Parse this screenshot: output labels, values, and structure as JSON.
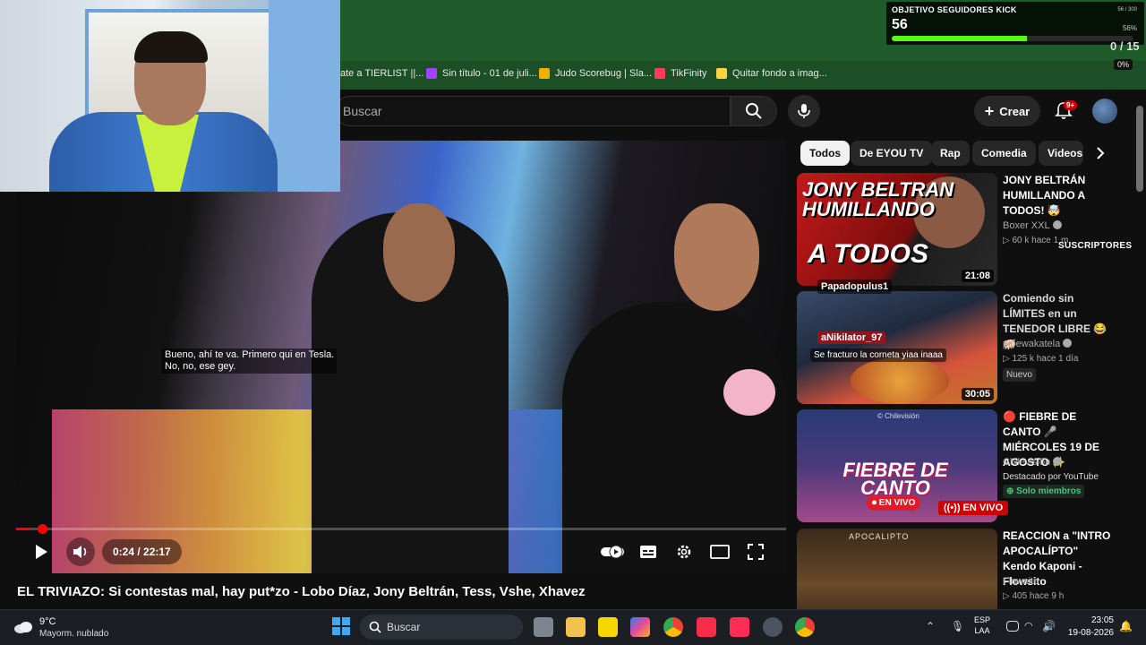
{
  "kick": {
    "title": "OBJETIVO SEGUIDORES KICK",
    "count": "56",
    "goal_small": "56 / 300",
    "percent": "56%",
    "progress": 0.56,
    "counter": "0 / 15",
    "badge": "0%"
  },
  "bookmarks": [
    {
      "label": "ate a TIERLIST ||...",
      "color": "#1c4f25"
    },
    {
      "label": "Sin título - 01 de juli...",
      "color": "#a640ff"
    },
    {
      "label": "Judo Scorebug | Sla...",
      "color": "#f0b000"
    },
    {
      "label": "TikFinity",
      "color": "#ff3b5c"
    },
    {
      "label": "Quitar fondo a imag...",
      "color": "#ffd23f"
    }
  ],
  "header": {
    "search_placeholder": "Buscar",
    "create_label": "Crear",
    "notifications": "9+"
  },
  "player": {
    "subtitle": "Bueno, ahí te va. Primero qui en Tesla.\nNo, no, ese gey.",
    "time": "0:24 / 22:17",
    "progress": 0.018
  },
  "video_title": "EL TRIVIAZO: Si contestas mal, hay put*zo - Lobo Díaz, Jony Beltrán, Tess, Vshe, Xhavez",
  "chips": [
    "Todos",
    "De EYOU TV",
    "Rap",
    "Comedia",
    "Videos"
  ],
  "recs": [
    {
      "title": "JONY BELTRÁN HUMILLANDO A TODOS! 🤯",
      "channel": "Boxer XXL",
      "meta": "▷ 60 k  hace 1 m",
      "duration": "21:08",
      "thumb_line1": "JONY BELTRAN\nHUMILLANDO",
      "thumb_line2": "A TODOS"
    },
    {
      "title": "Comiendo sin LÍMITES en un TENEDOR LIBRE 😂🐖",
      "channel": "pipewakatela",
      "meta": "▷ 125 k  hace 1 día",
      "duration": "30:05",
      "tag": "Nuevo"
    },
    {
      "title": "🔴 FIEBRE DE CANTO 🎤 MIÉRCOLES 19 DE AGOSTO ✨",
      "channel": "Chilevisión",
      "meta": "Destacado por YouTube",
      "members": "⊕ Solo miembros",
      "live": "((•)) EN VIVO",
      "thumb_brand": "© Chilevisión",
      "thumb_title": "FIEBRE DE CANTO",
      "thumb_live": "⏺ EN VIVO"
    },
    {
      "title": "REACCION a \"INTRO APOCALÍPTO\" Kendo Kaponi - Flowsito",
      "channel": "Flowsito",
      "meta": "▷ 405  hace 9 h",
      "thumb_text": "APOCALIPTO"
    }
  ],
  "chat": {
    "user1": "Papadopulus1",
    "user2": "aNikilator_97",
    "message": "Se fracturo la corneta yiaa inaaa",
    "subs_overlay": "SUSCRIPTORES F"
  },
  "taskbar": {
    "temp": "9°C",
    "condition": "Mayorm. nublado",
    "search": "Buscar",
    "lang_top": "ESP",
    "lang_bottom": "LAA",
    "time": "23:05",
    "date": "19-08-2026"
  },
  "colors": {
    "chrome_green": "#1f5a2a",
    "kick_green": "#53fc18",
    "yt_red": "#ff0000",
    "yt_bg": "#0f0f0f"
  }
}
